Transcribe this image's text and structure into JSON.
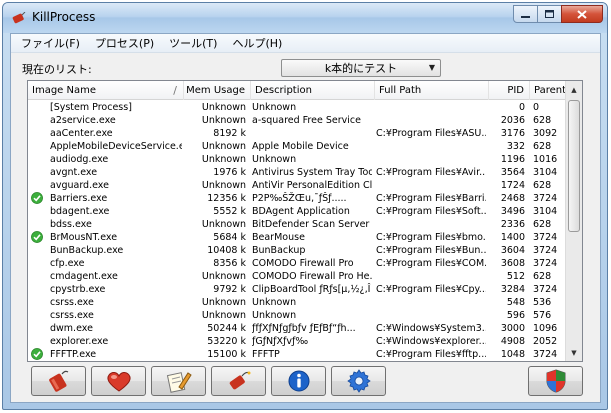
{
  "window": {
    "title": "KillProcess"
  },
  "menu": [
    "ファイル(F)",
    "プロセス(P)",
    "ツール(T)",
    "ヘルプ(H)"
  ],
  "list": {
    "label": "現在のリスト:",
    "selected": "k本的にテスト"
  },
  "columns": [
    "Image Name",
    "Mem Usage",
    "Description",
    "Full Path",
    "PID",
    "Parent ID"
  ],
  "rows": [
    {
      "checked": false,
      "name": "[System Process]",
      "mem": "Unknown",
      "desc": "Unknown",
      "path": "",
      "pid": "0",
      "ppid": "0"
    },
    {
      "checked": false,
      "name": "a2service.exe",
      "mem": "Unknown",
      "desc": "a-squared Free Service",
      "path": "",
      "pid": "2036",
      "ppid": "628"
    },
    {
      "checked": false,
      "name": "aaCenter.exe",
      "mem": "8192 k",
      "desc": "",
      "path": "C:¥Program Files¥ASU...",
      "pid": "3176",
      "ppid": "3092"
    },
    {
      "checked": false,
      "name": "AppleMobileDeviceService.exe",
      "mem": "Unknown",
      "desc": "Apple Mobile Device",
      "path": "",
      "pid": "332",
      "ppid": "628"
    },
    {
      "checked": false,
      "name": "audiodg.exe",
      "mem": "Unknown",
      "desc": "Unknown",
      "path": "",
      "pid": "1196",
      "ppid": "1016"
    },
    {
      "checked": false,
      "name": "avgnt.exe",
      "mem": "1976 k",
      "desc": "Antivirus System Tray Tool",
      "path": "C:¥Program Files¥Avir...",
      "pid": "3564",
      "ppid": "3104"
    },
    {
      "checked": false,
      "name": "avguard.exe",
      "mem": "Unknown",
      "desc": "AntiVir PersonalEdition Cl...",
      "path": "",
      "pid": "1724",
      "ppid": "628"
    },
    {
      "checked": true,
      "name": "Barriers.exe",
      "mem": "12356 k",
      "desc": "P2P‰ŠŽŒu‚¯ƒŠƒ.....",
      "path": "C:¥Program Files¥Barri...",
      "pid": "2468",
      "ppid": "3724"
    },
    {
      "checked": false,
      "name": "bdagent.exe",
      "mem": "5552 k",
      "desc": "BDAgent Application",
      "path": "C:¥Program Files¥Soft...",
      "pid": "3496",
      "ppid": "3104"
    },
    {
      "checked": false,
      "name": "bdss.exe",
      "mem": "Unknown",
      "desc": "BitDefender Scan Server",
      "path": "",
      "pid": "2336",
      "ppid": "628"
    },
    {
      "checked": true,
      "name": "BrMousNT.exe",
      "mem": "5684 k",
      "desc": "BearMouse",
      "path": "C:¥Program Files¥bmo...",
      "pid": "1400",
      "ppid": "3724"
    },
    {
      "checked": false,
      "name": "BunBackup.exe",
      "mem": "10408 k",
      "desc": "BunBackup",
      "path": "C:¥Program Files¥Bun...",
      "pid": "3604",
      "ppid": "3724"
    },
    {
      "checked": false,
      "name": "cfp.exe",
      "mem": "8356 k",
      "desc": "COMODO Firewall Pro",
      "path": "C:¥Program Files¥COM...",
      "pid": "3608",
      "ppid": "3724"
    },
    {
      "checked": false,
      "name": "cmdagent.exe",
      "mem": "Unknown",
      "desc": "COMODO Firewall Pro He...",
      "path": "",
      "pid": "512",
      "ppid": "628"
    },
    {
      "checked": false,
      "name": "cpystrb.exe",
      "mem": "9792 k",
      "desc": "ClipBoardTool ƒRƒs[µ,½¿‚Î",
      "path": "C:¥Program Files¥Cpy...",
      "pid": "3284",
      "ppid": "3724"
    },
    {
      "checked": false,
      "name": "csrss.exe",
      "mem": "Unknown",
      "desc": "Unknown",
      "path": "",
      "pid": "548",
      "ppid": "536"
    },
    {
      "checked": false,
      "name": "csrss.exe",
      "mem": "Unknown",
      "desc": "Unknown",
      "path": "",
      "pid": "596",
      "ppid": "576"
    },
    {
      "checked": false,
      "name": "dwm.exe",
      "mem": "50244 k",
      "desc": "ƒfƒXƒNƒgƒbƒv ƒEƒBƒ“ƒh...",
      "path": "C:¥Windows¥System3...",
      "pid": "3000",
      "ppid": "1096"
    },
    {
      "checked": false,
      "name": "explorer.exe",
      "mem": "53220 k",
      "desc": "ƒGƒNƒXƒvƒ‰",
      "path": "C:¥Windows¥explorer....",
      "pid": "4908",
      "ppid": "2052"
    },
    {
      "checked": true,
      "name": "FFFTP.exe",
      "mem": "15100 k",
      "desc": "FFFTP",
      "path": "C:¥Program Files¥fftp...",
      "pid": "1048",
      "ppid": "3724"
    }
  ],
  "icons": {
    "app": "dynamite-icon",
    "check": "green-check-icon",
    "toolbar": [
      "dynamite-kill-icon",
      "heart-icon",
      "notepad-pencil-icon",
      "dynamite-fuse-icon",
      "info-icon",
      "gear-icon",
      "shield-icon"
    ]
  },
  "colors": {
    "check": "#3cae3c",
    "dynamite": "#c8321e",
    "info": "#1d63c9",
    "gear": "#2f73d6"
  }
}
